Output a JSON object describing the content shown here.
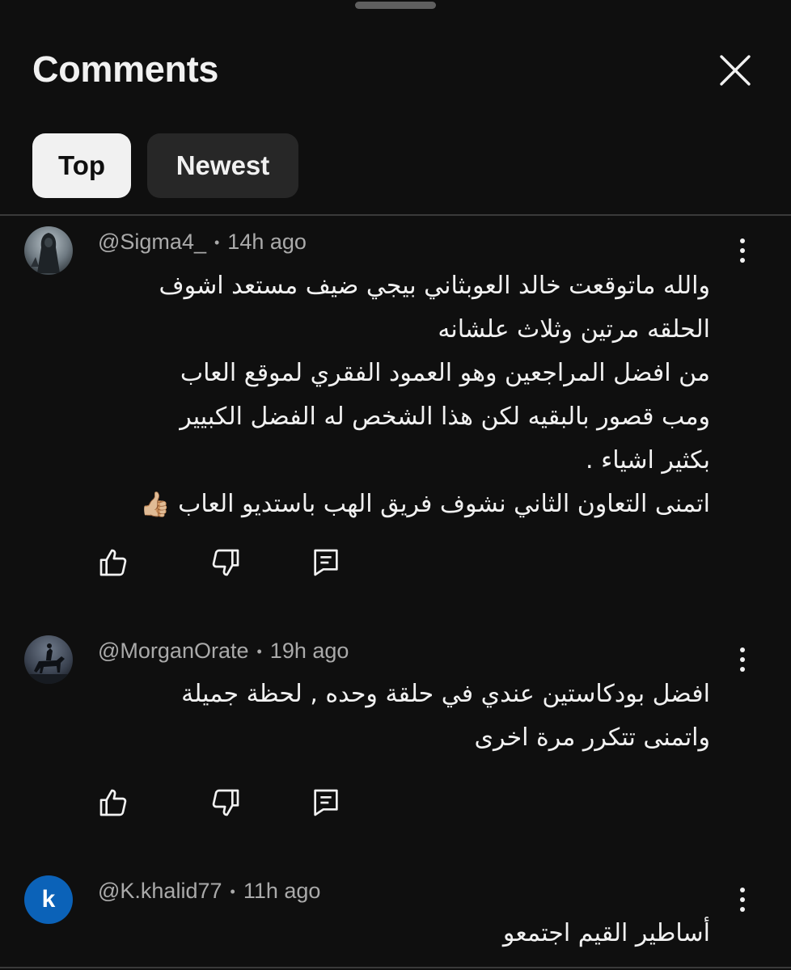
{
  "header": {
    "title": "Comments",
    "close_icon": "close-icon"
  },
  "sort_chips": [
    {
      "label": "Top",
      "selected": true
    },
    {
      "label": "Newest",
      "selected": false
    }
  ],
  "comments": [
    {
      "author": "@Sigma4_",
      "time": "14h ago",
      "avatar": "hooded-figure-avatar",
      "lines": [
        "والله ماتوقعت خالد العوبثاني بيجي ضيف مستعد اشوف",
        "الحلقه مرتين وثلاث علشانه",
        "من افضل المراجعين وهو العمود الفقري لموقع العاب",
        "ومب قصور بالبقيه لكن هذا الشخص له الفضل الكبيير",
        "بكثير اشياء .",
        "اتمنى التعاون الثاني نشوف فريق الهب باستديو العاب"
      ],
      "emoji": "👍🏼"
    },
    {
      "author": "@MorganOrate",
      "time": "19h ago",
      "avatar": "horse-rider-avatar",
      "lines": [
        "افضل بودكاستين عندي في حلقة وحده , لحظة جميلة",
        "واتمنى تتكرر مرة اخرى"
      ]
    },
    {
      "author": "@K.khalid77",
      "time": "11h ago",
      "avatar_letter": "k",
      "lines": [
        "أساطير القيم اجتمعو"
      ]
    }
  ],
  "icons": {
    "like": "thumbs-up-icon",
    "dislike": "thumbs-down-icon",
    "reply": "reply-comment-icon",
    "more": "more-vertical-icon"
  },
  "colors": {
    "background": "#0f0f0f",
    "chip_selected": "#f1f1f1",
    "chip_unselected": "#272727",
    "meta_text": "#aaaaaa",
    "letter_avatar": "#0b62b8"
  }
}
